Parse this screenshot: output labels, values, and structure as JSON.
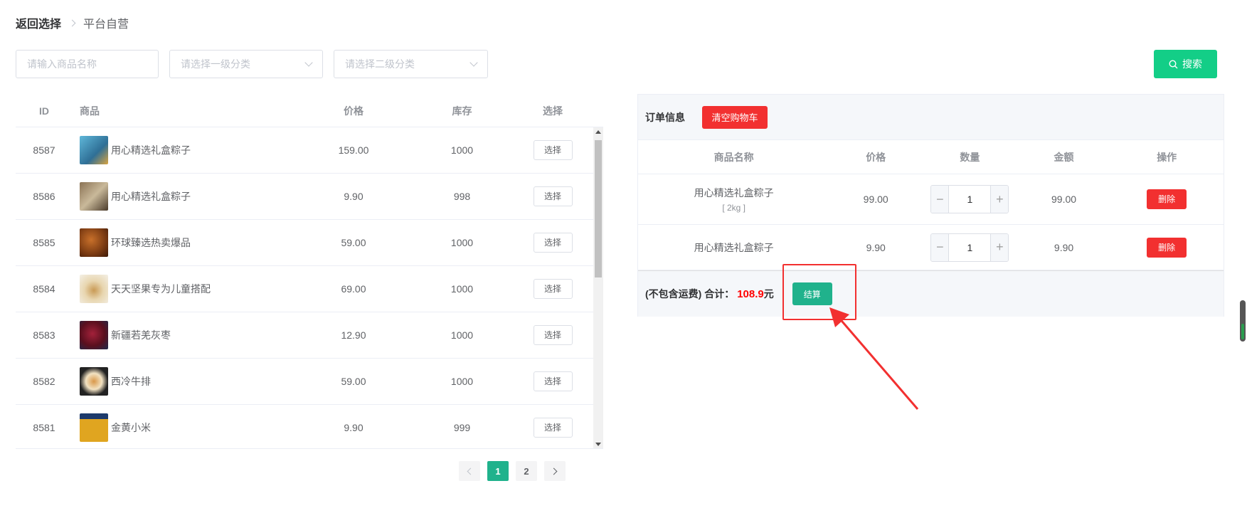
{
  "breadcrumb": {
    "back": "返回选择",
    "current": "平台自营"
  },
  "filters": {
    "name_placeholder": "请输入商品名称",
    "cat1_placeholder": "请选择一级分类",
    "cat2_placeholder": "请选择二级分类",
    "search_label": "搜索"
  },
  "product_table": {
    "headers": {
      "id": "ID",
      "goods": "商品",
      "price": "价格",
      "stock": "库存",
      "select": "选择"
    },
    "select_label": "选择",
    "rows": [
      {
        "id": "8587",
        "name": "用心精选礼盒粽子",
        "price": "159.00",
        "stock": "1000"
      },
      {
        "id": "8586",
        "name": "用心精选礼盒粽子",
        "price": "9.90",
        "stock": "998"
      },
      {
        "id": "8585",
        "name": "环球臻选热卖爆品",
        "price": "59.00",
        "stock": "1000"
      },
      {
        "id": "8584",
        "name": "天天坚果专为儿童搭配",
        "price": "69.00",
        "stock": "1000"
      },
      {
        "id": "8583",
        "name": "新疆若羌灰枣",
        "price": "12.90",
        "stock": "1000"
      },
      {
        "id": "8582",
        "name": "西冷牛排",
        "price": "59.00",
        "stock": "1000"
      },
      {
        "id": "8581",
        "name": "金黄小米",
        "price": "9.90",
        "stock": "999"
      }
    ]
  },
  "pagination": {
    "pages": [
      "1",
      "2"
    ],
    "current": "1"
  },
  "order": {
    "title": "订单信息",
    "clear_label": "清空购物车",
    "headers": {
      "name": "商品名称",
      "price": "价格",
      "qty": "数量",
      "amount": "金额",
      "op": "操作"
    },
    "delete_label": "删除",
    "items": [
      {
        "name": "用心精选礼盒粽子",
        "spec": "[ 2kg ]",
        "price": "99.00",
        "qty": "1",
        "amount": "99.00"
      },
      {
        "name": "用心精选礼盒粽子",
        "spec": "",
        "price": "9.90",
        "qty": "1",
        "amount": "9.90"
      }
    ],
    "total_label": "(不包含运费) 合计：",
    "total_value": "108.9",
    "total_unit": "元",
    "checkout_label": "结算"
  },
  "colors": {
    "accent": "#20b28c",
    "search": "#13ce87",
    "danger": "#f23030"
  }
}
